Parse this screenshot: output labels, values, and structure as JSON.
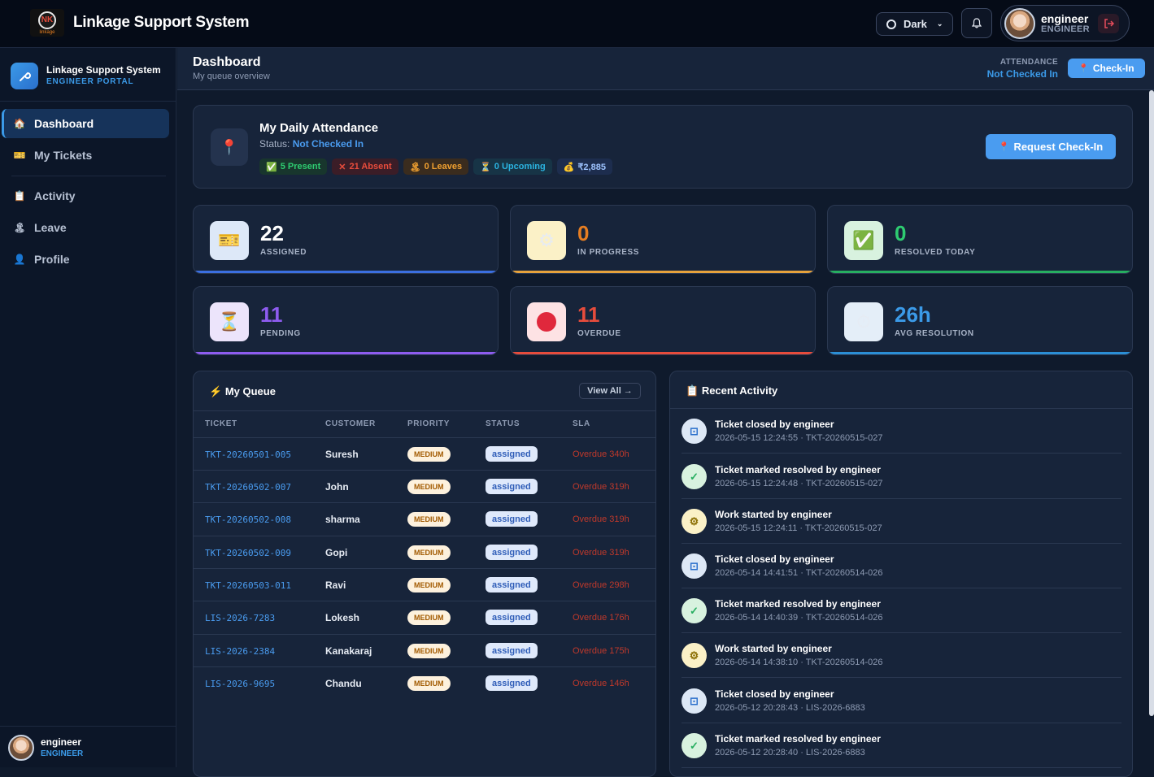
{
  "topbar": {
    "logo_text": "NK",
    "logo_sub": "linkage",
    "title": "Linkage Support System",
    "theme_label": "Dark",
    "user_name": "engineer",
    "user_role": "ENGINEER"
  },
  "sidebar": {
    "title": "Linkage Support System",
    "subtitle": "ENGINEER PORTAL",
    "items": [
      {
        "label": "Dashboard",
        "icon": "home-icon"
      },
      {
        "label": "My Tickets",
        "icon": "ticket-icon"
      },
      {
        "label": "Activity",
        "icon": "clipboard-icon"
      },
      {
        "label": "Leave",
        "icon": "beach-icon"
      },
      {
        "label": "Profile",
        "icon": "user-icon"
      }
    ],
    "footer_name": "engineer",
    "footer_role": "ENGINEER"
  },
  "subheader": {
    "title": "Dashboard",
    "subtitle": "My queue overview",
    "attendance_label": "ATTENDANCE",
    "attendance_value": "Not Checked In",
    "checkin_label": "Check-In"
  },
  "attendance": {
    "title": "My Daily Attendance",
    "status_prefix": "Status:",
    "status_value": "Not Checked In",
    "chips": [
      "5 Present",
      "21 Absent",
      "0 Leaves",
      "0 Upcoming",
      "₹2,885"
    ],
    "request_label": "Request Check-In"
  },
  "stats": [
    {
      "value": "22",
      "label": "ASSIGNED",
      "color": "#ffffff",
      "bar": "#3b6fe0",
      "icon": "ticket-icon"
    },
    {
      "value": "0",
      "label": "IN PROGRESS",
      "color": "#e67e22",
      "bar": "#e6a23c",
      "icon": "gear-icon"
    },
    {
      "value": "0",
      "label": "RESOLVED TODAY",
      "color": "#2ecc71",
      "bar": "#27ae60",
      "icon": "check-icon"
    },
    {
      "value": "11",
      "label": "PENDING",
      "color": "#8e5cf0",
      "bar": "#8e5cf0",
      "icon": "hourglass-icon"
    },
    {
      "value": "11",
      "label": "OVERDUE",
      "color": "#e74c3c",
      "bar": "#e74c3c",
      "icon": "red-circle-icon"
    },
    {
      "value": "26h",
      "label": "AVG RESOLUTION",
      "color": "#3b9ae8",
      "bar": "#2b8fd6",
      "icon": "stopwatch-icon"
    }
  ],
  "queue": {
    "title": "My Queue",
    "view_all": "View All →",
    "columns": [
      "TICKET",
      "CUSTOMER",
      "PRIORITY",
      "STATUS",
      "SLA"
    ],
    "rows": [
      {
        "ticket": "TKT-20260501-005",
        "customer": "Suresh",
        "priority": "MEDIUM",
        "status": "assigned",
        "sla": "Overdue 340h"
      },
      {
        "ticket": "TKT-20260502-007",
        "customer": "John",
        "priority": "MEDIUM",
        "status": "assigned",
        "sla": "Overdue 319h"
      },
      {
        "ticket": "TKT-20260502-008",
        "customer": "sharma",
        "priority": "MEDIUM",
        "status": "assigned",
        "sla": "Overdue 319h"
      },
      {
        "ticket": "TKT-20260502-009",
        "customer": "Gopi",
        "priority": "MEDIUM",
        "status": "assigned",
        "sla": "Overdue 319h"
      },
      {
        "ticket": "TKT-20260503-011",
        "customer": "Ravi",
        "priority": "MEDIUM",
        "status": "assigned",
        "sla": "Overdue 298h"
      },
      {
        "ticket": "LIS-2026-7283",
        "customer": "Lokesh",
        "priority": "MEDIUM",
        "status": "assigned",
        "sla": "Overdue 176h"
      },
      {
        "ticket": "LIS-2026-2384",
        "customer": "Kanakaraj",
        "priority": "MEDIUM",
        "status": "assigned",
        "sla": "Overdue 175h"
      },
      {
        "ticket": "LIS-2026-9695",
        "customer": "Chandu",
        "priority": "MEDIUM",
        "status": "assigned",
        "sla": "Overdue 146h"
      }
    ]
  },
  "activity": {
    "title": "Recent Activity",
    "items": [
      {
        "title": "Ticket closed by engineer",
        "meta": "2026-05-15 12:24:55 · TKT-20260515-027",
        "kind": "blue"
      },
      {
        "title": "Ticket marked resolved by engineer",
        "meta": "2026-05-15 12:24:48 · TKT-20260515-027",
        "kind": "green"
      },
      {
        "title": "Work started by engineer",
        "meta": "2026-05-15 12:24:11 · TKT-20260515-027",
        "kind": "yellow"
      },
      {
        "title": "Ticket closed by engineer",
        "meta": "2026-05-14 14:41:51 · TKT-20260514-026",
        "kind": "blue"
      },
      {
        "title": "Ticket marked resolved by engineer",
        "meta": "2026-05-14 14:40:39 · TKT-20260514-026",
        "kind": "green"
      },
      {
        "title": "Work started by engineer",
        "meta": "2026-05-14 14:38:10 · TKT-20260514-026",
        "kind": "yellow"
      },
      {
        "title": "Ticket closed by engineer",
        "meta": "2026-05-12 20:28:43 · LIS-2026-6883",
        "kind": "blue"
      },
      {
        "title": "Ticket marked resolved by engineer",
        "meta": "2026-05-12 20:28:40 · LIS-2026-6883",
        "kind": "green"
      }
    ]
  }
}
